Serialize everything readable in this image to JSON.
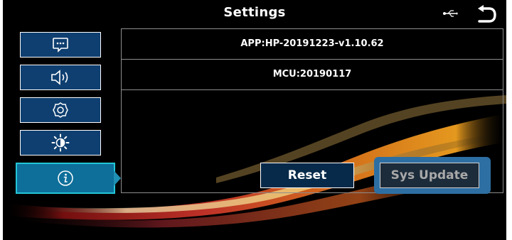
{
  "header": {
    "title": "Settings",
    "usb_icon": "usb-icon",
    "back_icon": "back-arrow-icon"
  },
  "sidebar": {
    "items": [
      {
        "id": "general",
        "icon": "chat-bubble-icon",
        "active": false
      },
      {
        "id": "sound",
        "icon": "speaker-icon",
        "active": false
      },
      {
        "id": "system",
        "icon": "gear-icon",
        "active": false
      },
      {
        "id": "display",
        "icon": "brightness-icon",
        "active": false
      },
      {
        "id": "about",
        "icon": "info-icon",
        "active": true
      }
    ]
  },
  "info": {
    "app_version": "APP:HP-20191223-v1.10.62",
    "mcu_version": "MCU:20190117"
  },
  "actions": {
    "reset_label": "Reset",
    "update_label": "Sys Update"
  },
  "colors": {
    "background": "#000000",
    "sidebar_item": "#0f3f70",
    "sidebar_active": "#0e6f9a",
    "active_border": "#23c6d8",
    "update_highlight": "#2e6fa3"
  }
}
